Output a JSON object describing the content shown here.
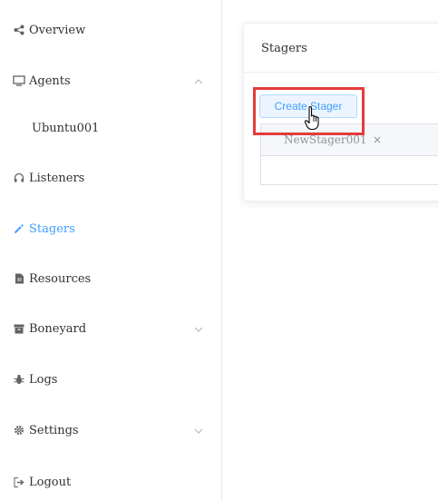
{
  "sidebar": {
    "items": [
      {
        "label": "Overview",
        "icon": "share-icon"
      },
      {
        "label": "Agents",
        "icon": "monitor-icon",
        "expanded": true,
        "children": [
          {
            "label": "Ubuntu001"
          }
        ]
      },
      {
        "label": "Listeners",
        "icon": "headset-icon"
      },
      {
        "label": "Stagers",
        "icon": "magic-wand-icon",
        "active": true
      },
      {
        "label": "Resources",
        "icon": "document-icon"
      },
      {
        "label": "Boneyard",
        "icon": "archive-icon",
        "expandable": true
      },
      {
        "label": "Logs",
        "icon": "bug-icon"
      },
      {
        "label": "Settings",
        "icon": "gear-icon",
        "expandable": true
      },
      {
        "label": "Logout",
        "icon": "logout-icon"
      }
    ]
  },
  "main": {
    "card_title": "Stagers",
    "create_button_label": "Create Stager",
    "tabs": [
      {
        "label": "NewStager001"
      }
    ]
  },
  "colors": {
    "accent": "#409eff",
    "highlight": "#e53b3b",
    "text": "#303133",
    "muted": "#909399"
  }
}
